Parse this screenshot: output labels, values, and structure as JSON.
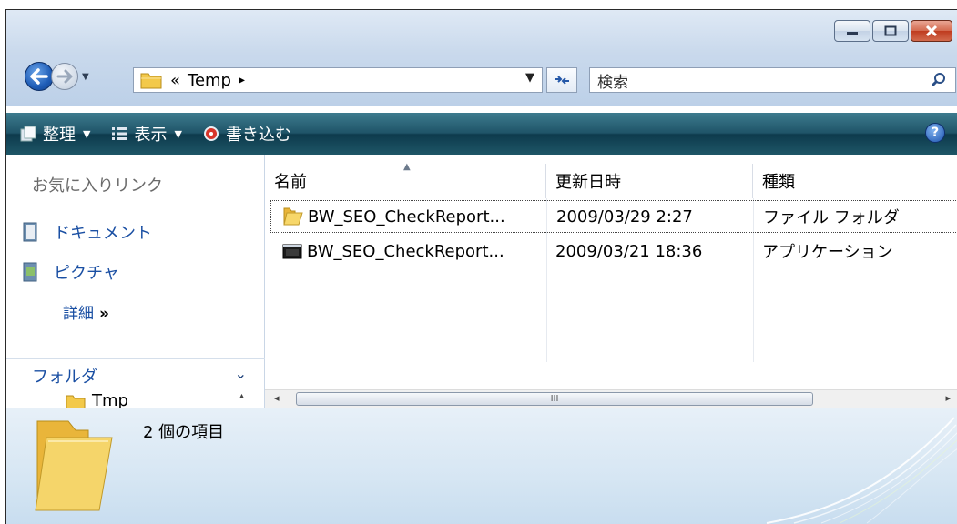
{
  "window": {
    "caption_buttons": [
      "minimize-icon",
      "maximize-icon",
      "close-icon"
    ]
  },
  "address_bar": {
    "prefix": "«",
    "current_folder": "Temp",
    "separator": "▸"
  },
  "search": {
    "placeholder": "検索"
  },
  "toolbar": {
    "organize": "整理",
    "views": "表示",
    "burn": "書き込む"
  },
  "sidebar": {
    "favorites_title": "お気に入りリンク",
    "links": [
      {
        "label": "ドキュメント",
        "icon": "documents-icon"
      },
      {
        "label": "ピクチャ",
        "icon": "pictures-icon"
      }
    ],
    "more_label": "詳細",
    "more_glyph": "»",
    "folders_label": "フォルダ",
    "tree_item": "Tmp"
  },
  "columns": {
    "name": "名前",
    "modified": "更新日時",
    "type": "種類"
  },
  "files": [
    {
      "name": "BW_SEO_CheckReport...",
      "modified": "2009/03/29 2:27",
      "type": "ファイル フォルダ",
      "icon": "folder-icon",
      "selected": true
    },
    {
      "name": "BW_SEO_CheckReport...",
      "modified": "2009/03/21 18:36",
      "type": "アプリケーション",
      "icon": "application-icon",
      "selected": false
    }
  ],
  "scrollbar": {
    "grip": "III"
  },
  "details_pane": {
    "item_count": "2 個の項目"
  },
  "colors": {
    "toolbar_dark": "#0d3a4c",
    "link_blue": "#1a4fa3",
    "folder_yellow": "#f3c94a"
  }
}
